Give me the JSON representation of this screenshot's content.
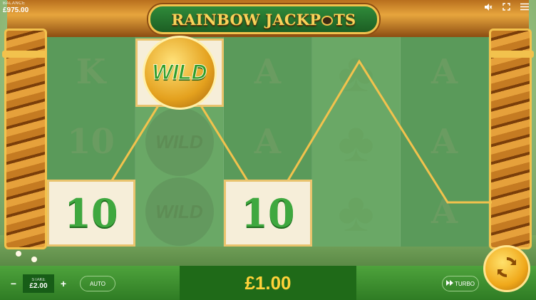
{
  "balance": {
    "label": "BALANCE",
    "value": "£975.00"
  },
  "top_icons": {
    "mute": "speaker-muted-icon",
    "fullscreen": "fullscreen-icon",
    "menu": "hamburger-menu-icon"
  },
  "title": {
    "part1": "RAINBOW JACKP",
    "part2": "TS"
  },
  "reels": [
    [
      "K",
      "10",
      "10"
    ],
    [
      "WILD",
      "WILD",
      "WILD"
    ],
    [
      "A",
      "A",
      "10"
    ],
    [
      "clover",
      "clover",
      "clover"
    ],
    [
      "A",
      "A",
      "A"
    ]
  ],
  "winning_symbols": {
    "reel1_row3": "10",
    "reel2_row1": "WILD",
    "reel3_row3": "10"
  },
  "stake": {
    "label": "STAKE",
    "value": "£2.00",
    "minus": "−",
    "plus": "+"
  },
  "buttons": {
    "auto": "AUTO",
    "turbo": "TURBO"
  },
  "win": {
    "amount": "£1.00"
  },
  "colors": {
    "payline": "#f2c24d",
    "win_text": "#ffd23a",
    "bar_green": "#3d8f2f"
  }
}
